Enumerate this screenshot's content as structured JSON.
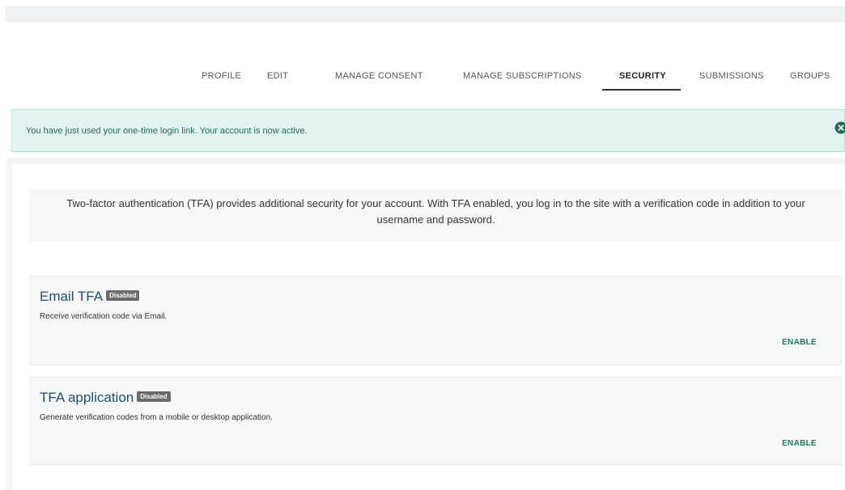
{
  "tabs": [
    {
      "label": "PROFILE"
    },
    {
      "label": "EDIT"
    },
    {
      "label": "MANAGE CONSENT"
    },
    {
      "label": "MANAGE SUBSCRIPTIONS"
    },
    {
      "label": "SECURITY",
      "active": true
    },
    {
      "label": "SUBMISSIONS"
    },
    {
      "label": "GROUPS"
    }
  ],
  "alert": {
    "message": "You have just used your one-time login link. Your account is now active.",
    "close_icon": "close-circle-icon",
    "color": "#1f6b5c"
  },
  "intro": {
    "text": "Two-factor authentication (TFA) provides additional security for your account. With TFA enabled, you log in to the site with a verification code in addition to your username and password."
  },
  "methods": [
    {
      "title": "Email TFA",
      "status": "Disabled",
      "description": "Receive verification code via Email.",
      "action": "ENABLE"
    },
    {
      "title": "TFA application",
      "status": "Disabled",
      "description": "Generate verification codes from a mobile or desktop application.",
      "action": "ENABLE"
    }
  ],
  "colors": {
    "accent": "#1f7a5c",
    "title": "#1f4e6e",
    "badge": "#6b6b6b"
  }
}
